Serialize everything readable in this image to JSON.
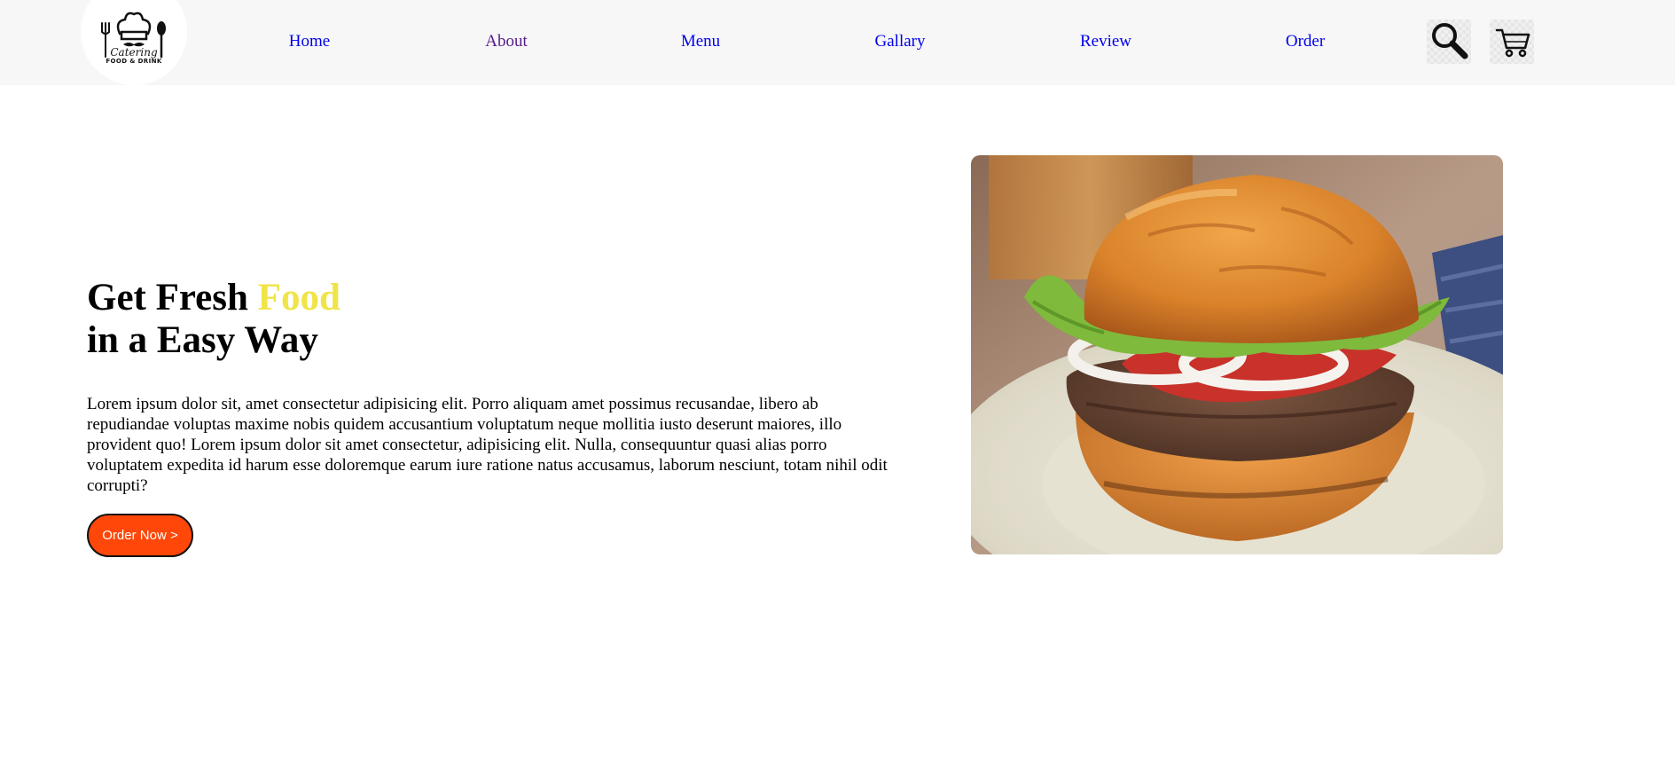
{
  "brand": {
    "logo_line1": "Catering",
    "logo_line2": "FOOD & DRINK"
  },
  "nav": {
    "items": [
      {
        "label": "Home"
      },
      {
        "label": "About"
      },
      {
        "label": "Menu"
      },
      {
        "label": "Gallary"
      },
      {
        "label": "Review"
      },
      {
        "label": "Order"
      }
    ],
    "icons": [
      "search-icon",
      "cart-icon"
    ]
  },
  "hero": {
    "title_part1": "Get Fresh ",
    "title_highlight": "Food",
    "title_line2": "in a Easy Way",
    "description": "Lorem ipsum dolor sit, amet consectetur adipisicing elit. Porro aliquam amet possimus recusandae, libero ab repudiandae voluptas maxime nobis quidem accusantium voluptatum neque mollitia iusto deserunt maiores, illo provident quo! Lorem ipsum dolor sit amet consectetur, adipisicing elit. Nulla, consequuntur quasi alias porro voluptatem expedita id harum esse doloremque earum iure ratione natus accusamus, laborum nesciunt, totam nihil odit corrupti?",
    "button_label": "Order Now >",
    "image": "burger-photo"
  },
  "colors": {
    "navbar_bg": "#f7f7f7",
    "accent_yellow": "#f0e448",
    "button_orange": "#ff4709",
    "link_blue": "#0000ee",
    "link_visited": "#551a8b"
  }
}
